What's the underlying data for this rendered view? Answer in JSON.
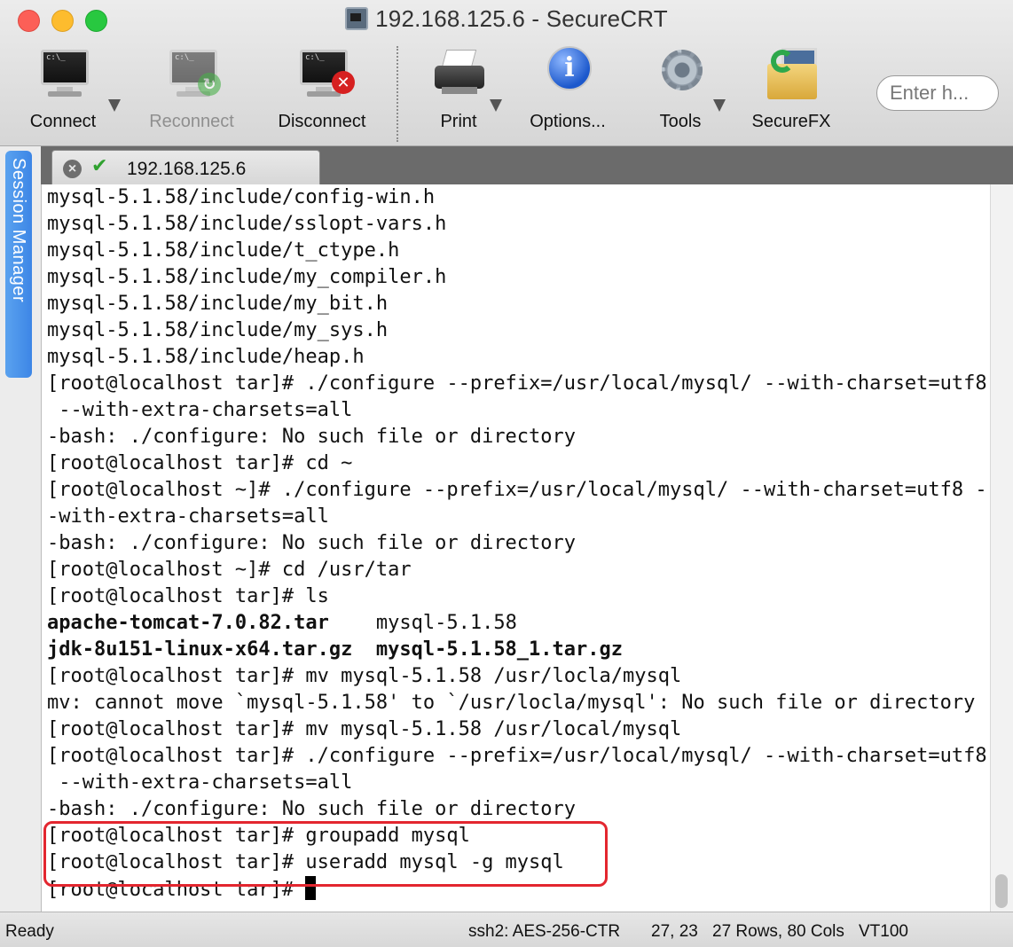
{
  "window": {
    "title": "192.168.125.6 - SecureCRT"
  },
  "toolbar": {
    "items": [
      {
        "label": "Connect",
        "icon": "connect-monitor-icon",
        "enabled": true
      },
      {
        "label": "Reconnect",
        "icon": "reconnect-monitor-icon",
        "enabled": false
      },
      {
        "label": "Disconnect",
        "icon": "disconnect-monitor-icon",
        "enabled": true
      },
      {
        "label": "Print",
        "icon": "printer-icon",
        "enabled": true
      },
      {
        "label": "Options...",
        "icon": "info-icon",
        "enabled": true
      },
      {
        "label": "Tools",
        "icon": "gear-icon",
        "enabled": true
      },
      {
        "label": "SecureFX",
        "icon": "securefx-icon",
        "enabled": true
      }
    ],
    "search_placeholder": "Enter h..."
  },
  "session_manager": {
    "label": "Session Manager"
  },
  "tabs": [
    {
      "label": "192.168.125.6",
      "status": "connected"
    }
  ],
  "terminal": {
    "lines": [
      {
        "text": "mysql-5.1.58/include/config-win.h"
      },
      {
        "text": "mysql-5.1.58/include/sslopt-vars.h"
      },
      {
        "text": "mysql-5.1.58/include/t_ctype.h"
      },
      {
        "text": "mysql-5.1.58/include/my_compiler.h"
      },
      {
        "text": "mysql-5.1.58/include/my_bit.h"
      },
      {
        "text": "mysql-5.1.58/include/my_sys.h"
      },
      {
        "text": "mysql-5.1.58/include/heap.h"
      },
      {
        "text": "[root@localhost tar]# ./configure --prefix=/usr/local/mysql/ --with-charset=utf8"
      },
      {
        "text": " --with-extra-charsets=all"
      },
      {
        "text": "-bash: ./configure: No such file or directory"
      },
      {
        "text": "[root@localhost tar]# cd ~"
      },
      {
        "text": "[root@localhost ~]# ./configure --prefix=/usr/local/mysql/ --with-charset=utf8 -"
      },
      {
        "text": "-with-extra-charsets=all"
      },
      {
        "text": "-bash: ./configure: No such file or directory"
      },
      {
        "text": "[root@localhost ~]# cd /usr/tar"
      },
      {
        "text": "[root@localhost tar]# ls"
      },
      {
        "text": "apache-tomcat-7.0.82.tar    mysql-5.1.58",
        "bold_prefix": "apache-tomcat-7.0.82.tar",
        "rest": "    mysql-5.1.58"
      },
      {
        "text": "jdk-8u151-linux-x64.tar.gz  mysql-5.1.58_1.tar.gz",
        "bold": true
      },
      {
        "text": "[root@localhost tar]# mv mysql-5.1.58 /usr/locla/mysql"
      },
      {
        "text": "mv: cannot move `mysql-5.1.58' to `/usr/locla/mysql': No such file or directory"
      },
      {
        "text": "[root@localhost tar]# mv mysql-5.1.58 /usr/local/mysql"
      },
      {
        "text": "[root@localhost tar]# ./configure --prefix=/usr/local/mysql/ --with-charset=utf8"
      },
      {
        "text": " --with-extra-charsets=all"
      },
      {
        "text": "-bash: ./configure: No such file or directory"
      },
      {
        "text": "[root@localhost tar]# groupadd mysql"
      },
      {
        "text": "[root@localhost tar]# useradd mysql -g mysql"
      },
      {
        "text": "[root@localhost tar]# "
      }
    ]
  },
  "statusbar": {
    "state": "Ready",
    "cipher": "ssh2: AES-256-CTR",
    "cursor_pos": "27, 23",
    "size": "27 Rows, 80 Cols",
    "emulation": "VT100"
  },
  "colors": {
    "highlight_box": "#e3262f",
    "session_manager": "#3d86e6"
  }
}
